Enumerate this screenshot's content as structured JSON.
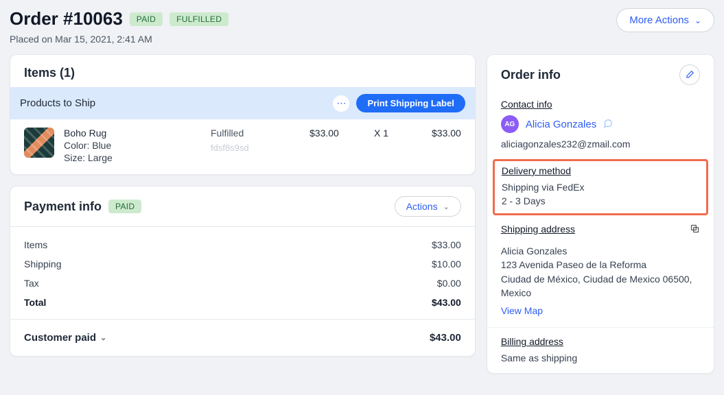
{
  "header": {
    "title": "Order #10063",
    "badge_paid": "PAID",
    "badge_fulfilled": "FULFILLED",
    "placed_on": "Placed on Mar 15, 2021, 2:41 AM",
    "more_actions": "More Actions"
  },
  "items_card": {
    "title": "Items (1)",
    "ship_header": "Products to Ship",
    "print_label": "Print Shipping Label",
    "item": {
      "name": "Boho Rug",
      "opt1": "Color: Blue",
      "opt2": "Size: Large",
      "status": "Fulfilled",
      "sku": "fdsf8s9sd",
      "price": "$33.00",
      "qty": "X 1",
      "total": "$33.00"
    }
  },
  "payment": {
    "title": "Payment info",
    "badge": "PAID",
    "actions": "Actions",
    "rows": {
      "items_label": "Items",
      "items_value": "$33.00",
      "shipping_label": "Shipping",
      "shipping_value": "$10.00",
      "tax_label": "Tax",
      "tax_value": "$0.00",
      "total_label": "Total",
      "total_value": "$43.00"
    },
    "customer_paid_label": "Customer paid",
    "customer_paid_value": "$43.00"
  },
  "order_info": {
    "title": "Order info",
    "contact": {
      "label": "Contact info",
      "initials": "AG",
      "name": "Alicia Gonzales",
      "email": "aliciagonzales232@zmail.com"
    },
    "delivery": {
      "label": "Delivery method",
      "line1": "Shipping via FedEx",
      "line2": "2 - 3 Days"
    },
    "shipping": {
      "label": "Shipping address",
      "name": "Alicia Gonzales",
      "line1": "123 Avenida Paseo de la Reforma",
      "line2": "Ciudad de México, Ciudad de Mexico 06500, Mexico",
      "view_map": "View Map"
    },
    "billing": {
      "label": "Billing address",
      "text": "Same as shipping"
    }
  }
}
